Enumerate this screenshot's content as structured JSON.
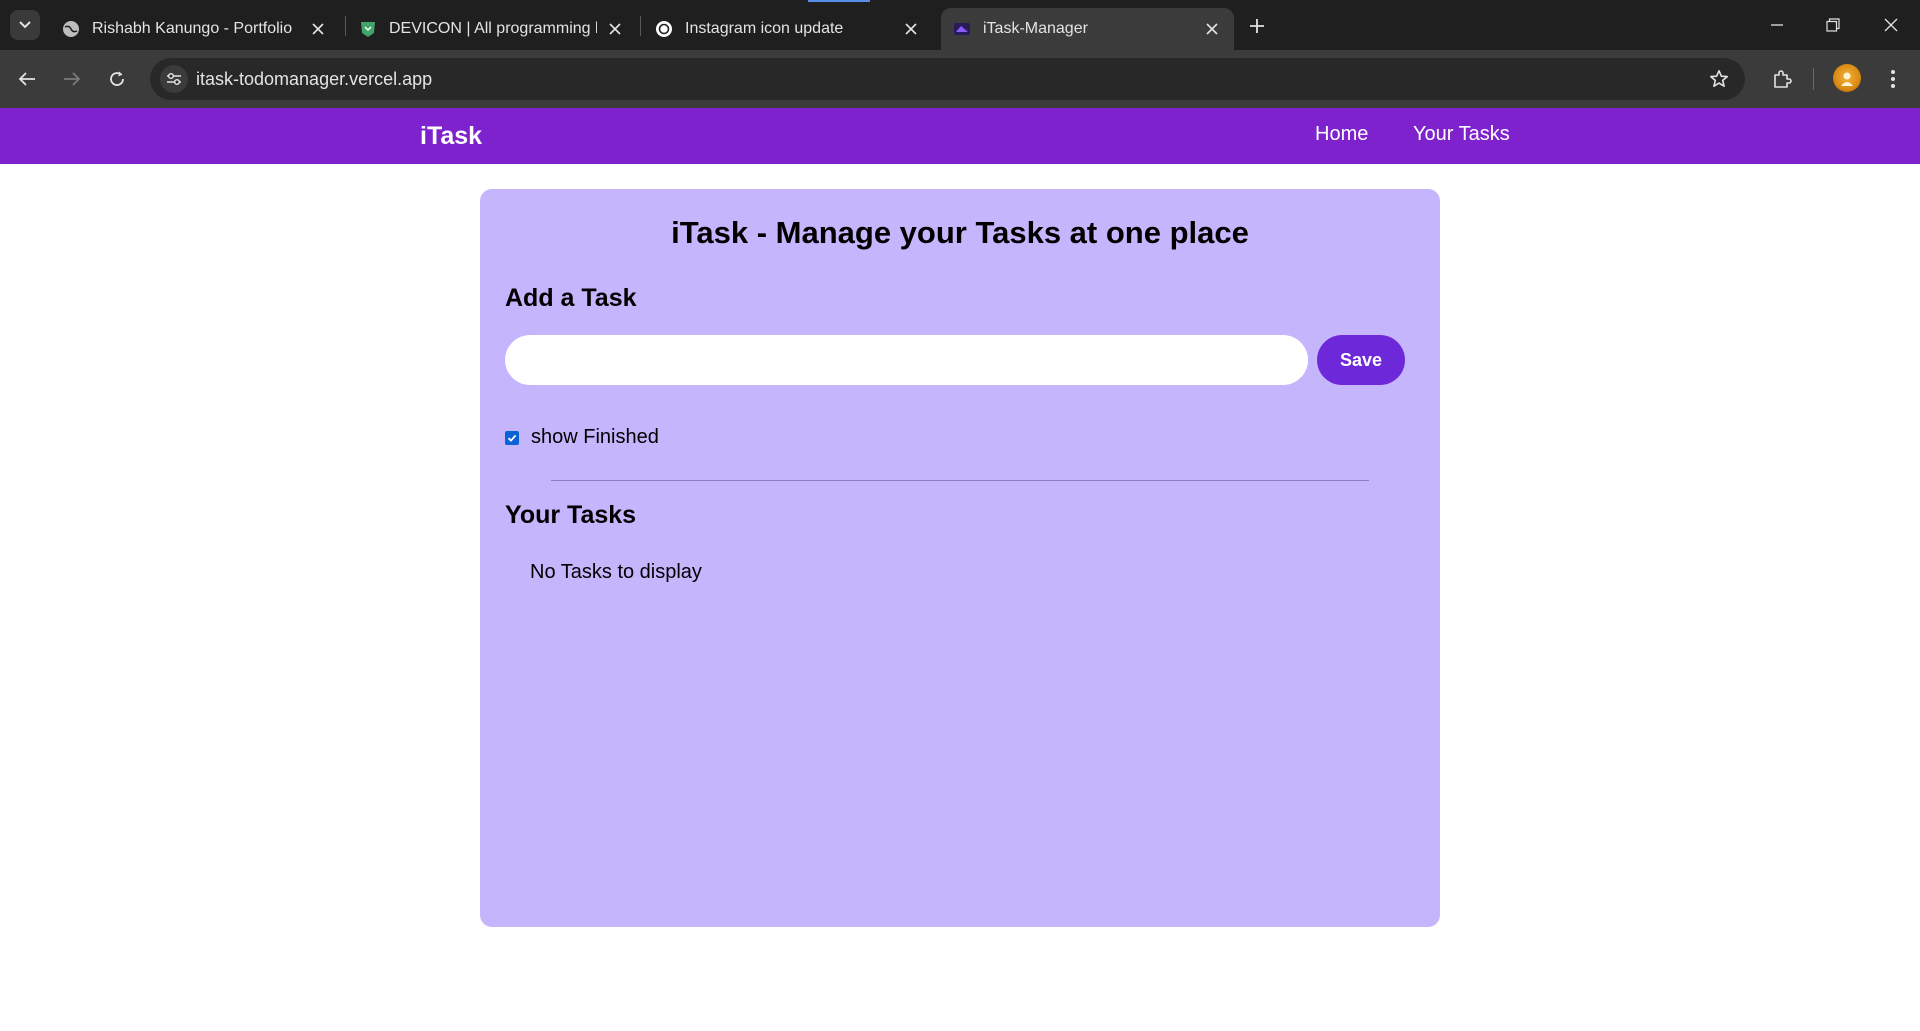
{
  "browser": {
    "tabs": [
      {
        "title": "Rishabh Kanungo - Portfolio",
        "favicon": "globe-icon"
      },
      {
        "title": "DEVICON | All programming lan",
        "favicon": "devicon-shield-icon"
      },
      {
        "title": "Instagram icon update",
        "favicon": "chatgpt-icon"
      },
      {
        "title": "iTask-Manager",
        "favicon": "itask-icon",
        "active": true
      }
    ],
    "url": "itask-todomanager.vercel.app"
  },
  "navbar": {
    "brand": "iTask",
    "links": [
      "Home",
      "Your Tasks"
    ],
    "background": "#7e22ce"
  },
  "main": {
    "heading": "iTask - Manage your Tasks at one place",
    "add_title": "Add a Task",
    "input": {
      "value": "",
      "placeholder": ""
    },
    "save_label": "Save",
    "show_finished": {
      "label": "show Finished",
      "checked": true
    },
    "tasks_title": "Your Tasks",
    "empty_message": "No Tasks to display",
    "card_color": "#c4b5fd",
    "button_color": "#6d28d9"
  }
}
